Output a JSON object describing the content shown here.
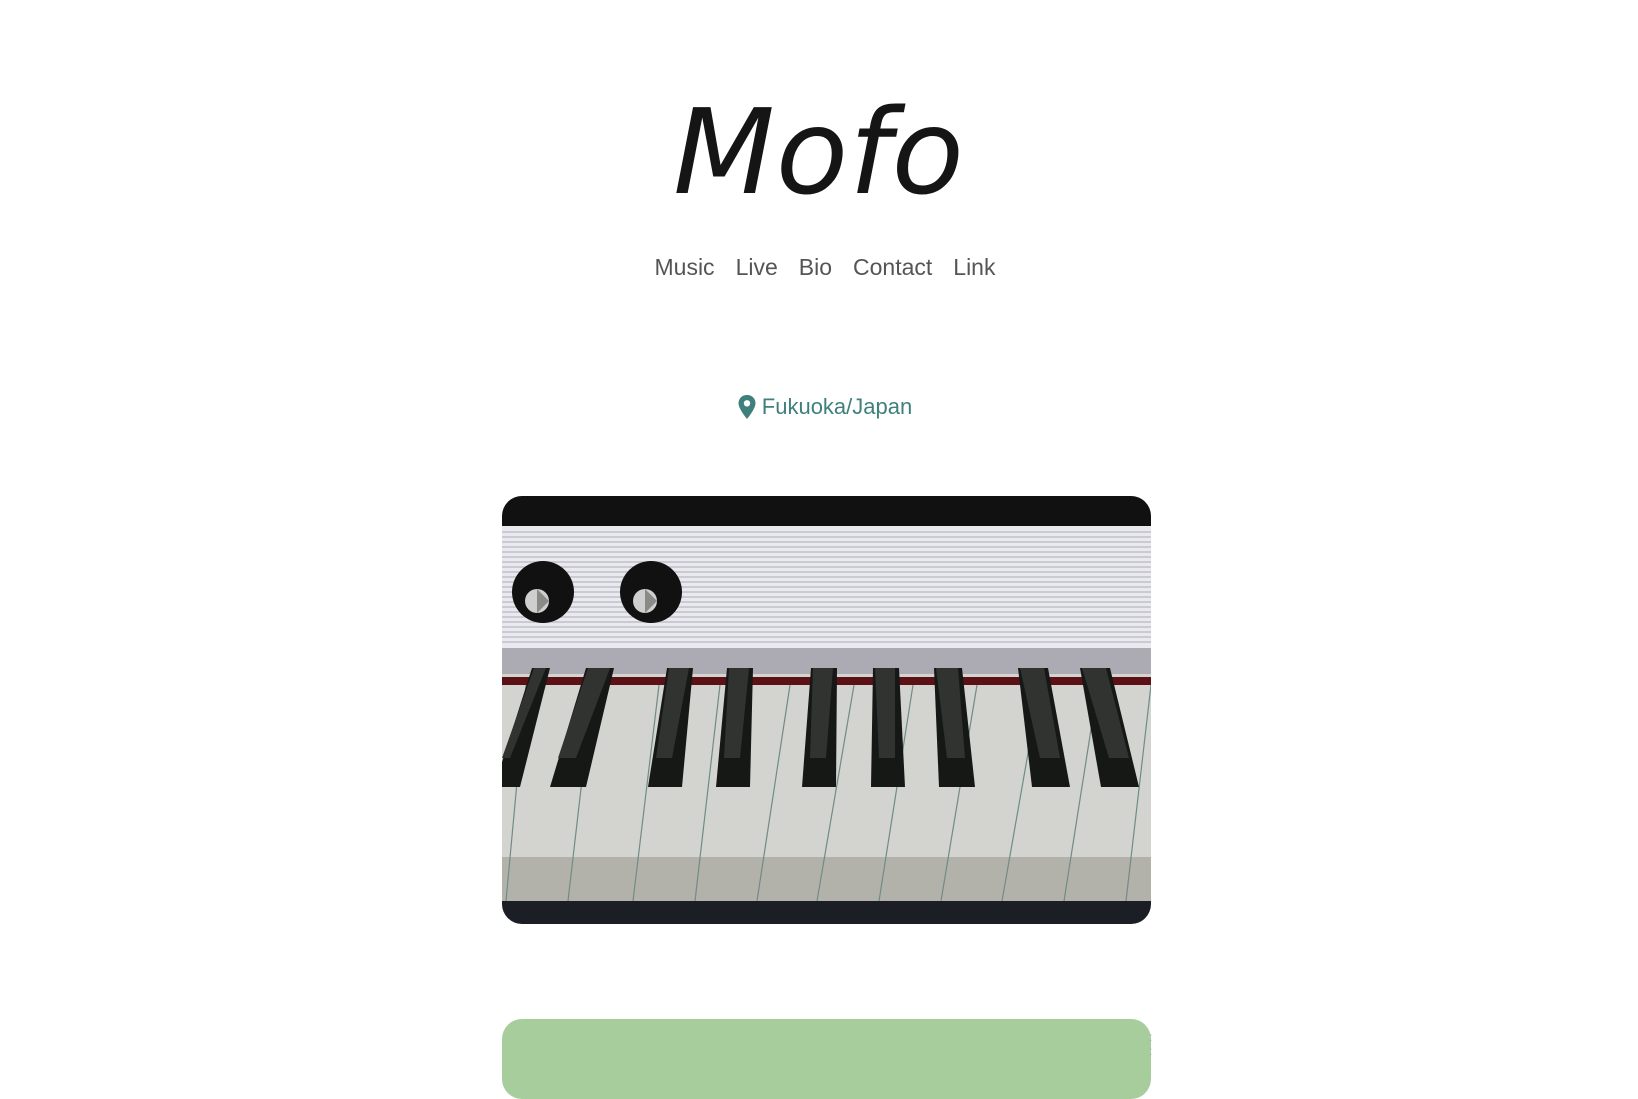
{
  "header": {
    "site_title": "Mofo"
  },
  "nav": {
    "items": [
      {
        "label": "Music"
      },
      {
        "label": "Live"
      },
      {
        "label": "Bio"
      },
      {
        "label": "Contact"
      },
      {
        "label": "Link"
      }
    ]
  },
  "location": {
    "icon": "map-pin-icon",
    "text": "Fukuoka/Japan",
    "color": "#3f7f7c"
  },
  "hero": {
    "image": "piano-keyboard-with-eyes-illustration"
  },
  "next_section": {
    "color": "#a8cd9c"
  },
  "colors": {
    "background": "#ffffff",
    "title": "#151515",
    "nav_text": "#555555"
  }
}
